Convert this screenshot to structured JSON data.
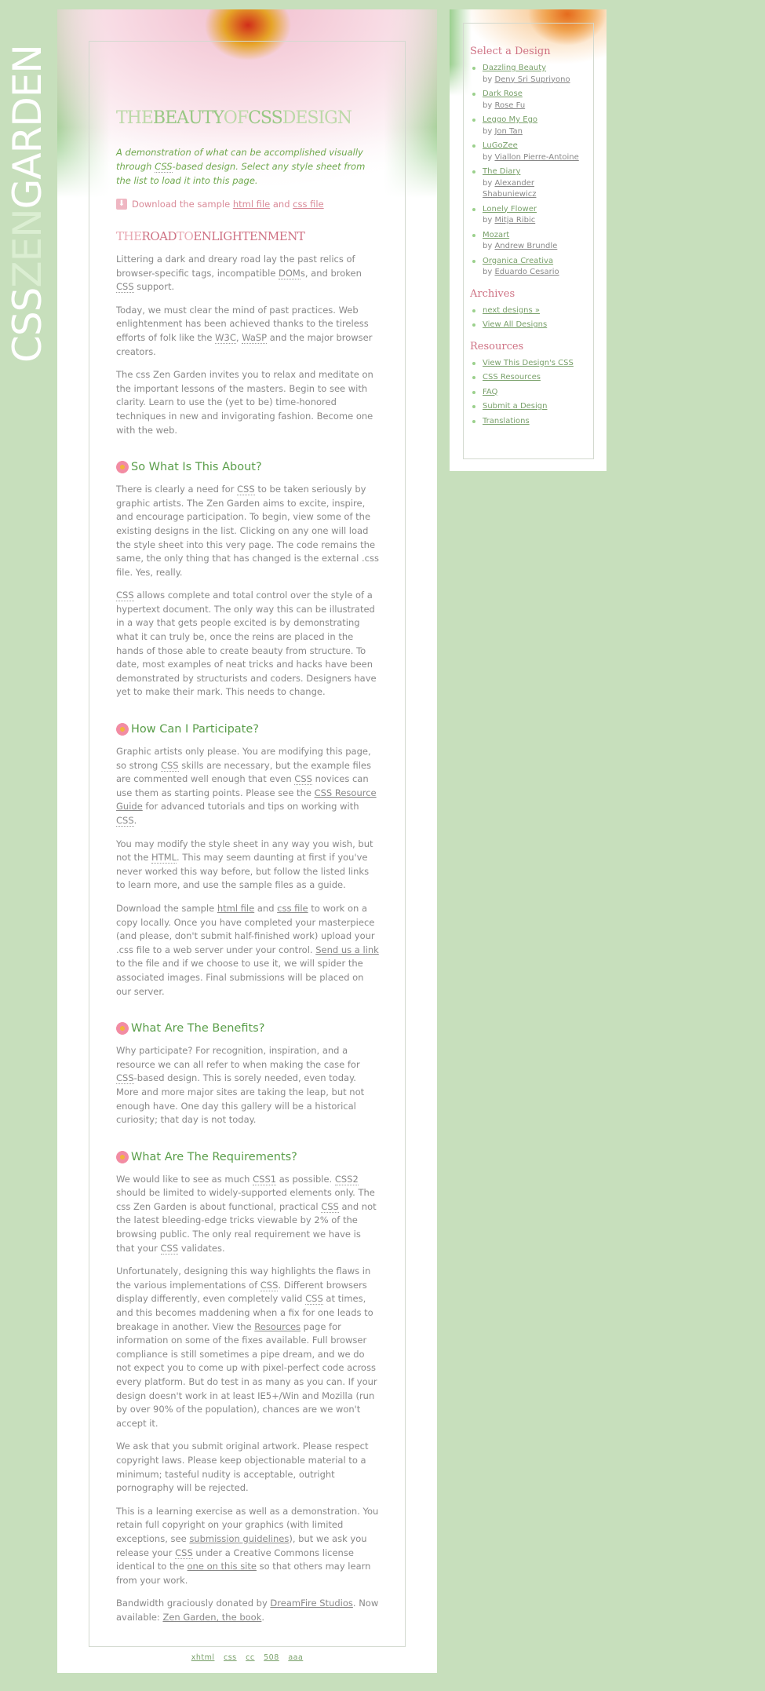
{
  "logo": {
    "part1": "CSS",
    "part2": "ZEN",
    "part3": "GARDEN"
  },
  "header": {
    "title": {
      "w1": "THE",
      "w2": "BEAUTY",
      "w3": "OF",
      "w4": "CSS",
      "w5": "DESIGN"
    },
    "tagline": {
      "t1": "A demonstration of what can be accomplished visually through ",
      "css": "CSS",
      "t2": "-based design. Select any style sheet from the list to load it into this page."
    },
    "download": {
      "t1": "Download the sample ",
      "html_link": "html file",
      "and": " and ",
      "css_link": "css file"
    }
  },
  "intro": {
    "title": {
      "w1": "THE",
      "w2": "ROAD",
      "w3": "TO",
      "w4": "ENLIGHTENMENT"
    },
    "p1": {
      "t1": "Littering a dark and dreary road lay the past relics of browser-specific tags, incompatible ",
      "doms": "DOM",
      "t2": "s, and broken ",
      "css": "CSS",
      "t3": " support."
    },
    "p2": {
      "t1": "Today, we must clear the mind of past practices. Web enlightenment has been achieved thanks to the tireless efforts of folk like the ",
      "w3c": "W3C",
      "t2": ", ",
      "wasp": "WaSP",
      "t3": " and the major browser creators."
    },
    "p3": "The css Zen Garden invites you to relax and meditate on the important lessons of the masters. Begin to see with clarity. Learn to use the (yet to be) time-honored techniques in new and invigorating fashion. Become one with the web."
  },
  "explanation": {
    "heading": "So What Is This About?",
    "p1": {
      "t1": "There is clearly a need for ",
      "css": "CSS",
      "t2": " to be taken seriously by graphic artists. The Zen Garden aims to excite, inspire, and encourage participation. To begin, view some of the existing designs in the list. Clicking on any one will load the style sheet into this very page. The code remains the same, the only thing that has changed is the external .css file. Yes, really."
    },
    "p2": {
      "css": "CSS",
      "t1": " allows complete and total control over the style of a hypertext document. The only way this can be illustrated in a way that gets people excited is by demonstrating what it can truly be, once the reins are placed in the hands of those able to create beauty from structure. To date, most examples of neat tricks and hacks have been demonstrated by structurists and coders. Designers have yet to make their mark. This needs to change."
    }
  },
  "participation": {
    "heading": "How Can I Participate?",
    "p1": {
      "t1": "Graphic artists only please. You are modifying this page, so strong ",
      "css1": "CSS",
      "t2": " skills are necessary, but the example files are commented well enough that even ",
      "css2": "CSS",
      "t3": " novices can use them as starting points. Please see the ",
      "guide": "CSS Resource Guide",
      "t4": " for advanced tutorials and tips on working with ",
      "css3": "CSS",
      "t5": "."
    },
    "p2": {
      "t1": "You may modify the style sheet in any way you wish, but not the ",
      "html": "HTML",
      "t2": ". This may seem daunting at first if you've never worked this way before, but follow the listed links to learn more, and use the sample files as a guide."
    },
    "p3": {
      "t1": "Download the sample ",
      "html_link": "html file",
      "t2": " and ",
      "css_link": "css file",
      "t3": " to work on a copy locally. Once you have completed your masterpiece (and please, don't submit half-finished work) upload your .css file to a web server under your control. ",
      "send": "Send us a link",
      "t4": " to the file and if we choose to use it, we will spider the associated images. Final submissions will be placed on our server."
    }
  },
  "benefits": {
    "heading": "What Are The Benefits?",
    "p1": {
      "t1": "Why participate? For recognition, inspiration, and a resource we can all refer to when making the case for ",
      "css": "CSS",
      "t2": "-based design. This is sorely needed, even today. More and more major sites are taking the leap, but not enough have. One day this gallery will be a historical curiosity; that day is not today."
    }
  },
  "requirements": {
    "heading": "What Are The Requirements?",
    "p1": {
      "t1": "We would like to see as much ",
      "css1": "CSS1",
      "t2": " as possible. ",
      "css2": "CSS2",
      "t3": " should be limited to widely-supported elements only. The css Zen Garden is about functional, practical ",
      "css3": "CSS",
      "t4": " and not the latest bleeding-edge tricks viewable by 2% of the browsing public. The only real requirement we have is that your ",
      "css4": "CSS",
      "t5": " validates."
    },
    "p2": {
      "t1": "Unfortunately, designing this way highlights the flaws in the various implementations of ",
      "css1": "CSS",
      "t2": ". Different browsers display differently, even completely valid ",
      "css2": "CSS",
      "t3": " at times, and this becomes maddening when a fix for one leads to breakage in another. View the ",
      "resources": "Resources",
      "t4": " page for information on some of the fixes available. Full browser compliance is still sometimes a pipe dream, and we do not expect you to come up with pixel-perfect code across every platform. But do test in as many as you can. If your design doesn't work in at least IE5+/Win and Mozilla (run by over 90% of the population), chances are we won't accept it."
    },
    "p3": "We ask that you submit original artwork. Please respect copyright laws. Please keep objectionable material to a minimum; tasteful nudity is acceptable, outright pornography will be rejected.",
    "p4": {
      "t1": "This is a learning exercise as well as a demonstration. You retain full copyright on your graphics (with limited exceptions, see ",
      "guidelines": "submission guidelines",
      "t2": "), but we ask you release your ",
      "css": "CSS",
      "t3": " under a Creative Commons license identical to the ",
      "site": "one on this site",
      "t4": " so that others may learn from your work."
    },
    "p5": {
      "t1": "Bandwidth graciously donated by ",
      "dreamfire": "DreamFire Studios",
      "t2": ". Now available: ",
      "book": "Zen Garden, the book",
      "t3": "."
    }
  },
  "footer": {
    "xhtml": "xhtml",
    "css": "css",
    "cc": "cc",
    "s508": "508",
    "aaa": "aaa"
  },
  "sidebar": {
    "select_title": "Select a Design",
    "by": "by ",
    "designs": [
      {
        "name": "Dazzling Beauty",
        "author": "Deny Sri Supriyono"
      },
      {
        "name": "Dark Rose",
        "author": "Rose Fu"
      },
      {
        "name": "Leggo My Ego",
        "author": "Jon Tan"
      },
      {
        "name": "LuGoZee",
        "author": "Viallon Pierre-Antoine"
      },
      {
        "name": "The Diary",
        "author": "Alexander Shabuniewicz"
      },
      {
        "name": "Lonely Flower",
        "author": "Mitja Ribic"
      },
      {
        "name": "Mozart",
        "author": "Andrew Brundle"
      },
      {
        "name": "Organica Creativa",
        "author": "Eduardo Cesario"
      }
    ],
    "archives_title": "Archives",
    "archives": [
      "next designs »",
      "View All Designs"
    ],
    "resources_title": "Resources",
    "resources": [
      "View This Design's CSS",
      "CSS Resources",
      "FAQ",
      "Submit a Design",
      "Translations"
    ]
  },
  "colors": {
    "background": "#c7dfbc",
    "green_heading": "#5a9e4a",
    "pink_heading": "#cf7284",
    "link": "#7aa16b"
  }
}
